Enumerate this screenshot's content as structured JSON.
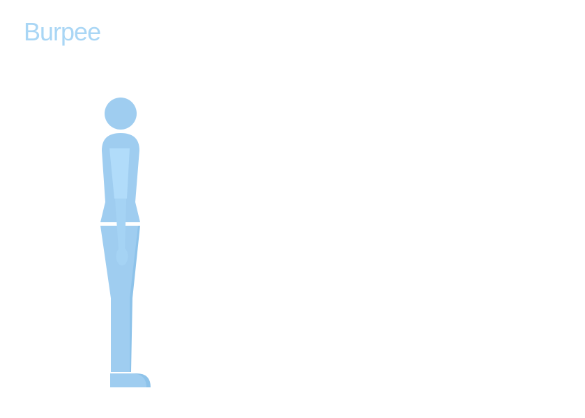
{
  "exercise": {
    "title": "Burpee"
  },
  "figure": {
    "icon": "standing-person-side-view-icon",
    "pose": "standing",
    "colors": {
      "body": "#9fcdf0",
      "arm": "#b1dcfa",
      "arm_shade": "#a5d3f4",
      "leg_back": "#8ec3ea",
      "title": "#a9d6f5",
      "background": "#ffffff"
    }
  }
}
